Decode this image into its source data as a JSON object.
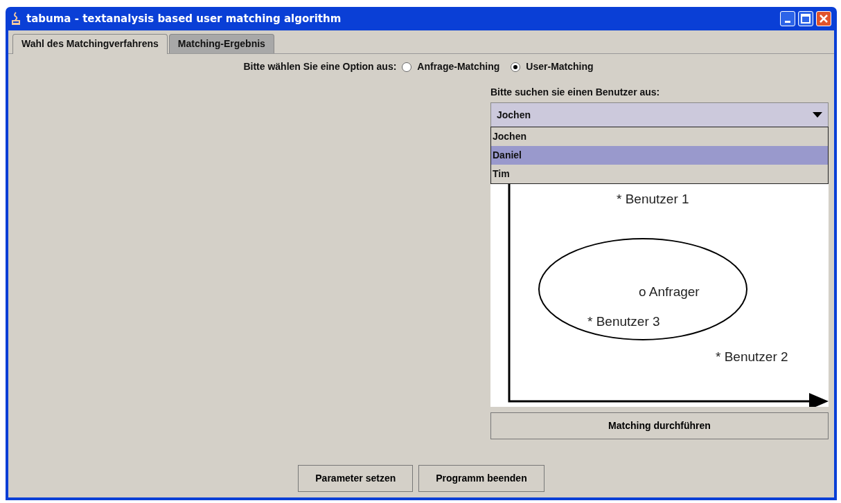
{
  "window": {
    "title": "tabuma - textanalysis based user matching algorithm"
  },
  "tabs": [
    {
      "label": "Wahl des Matchingverfahrens",
      "selected": true
    },
    {
      "label": "Matching-Ergebnis",
      "selected": false
    }
  ],
  "option_group": {
    "label": "Bitte wählen Sie eine Option aus:",
    "options": [
      {
        "label": "Anfrage-Matching",
        "selected": false
      },
      {
        "label": "User-Matching",
        "selected": true
      }
    ]
  },
  "user_select": {
    "label": "Bitte suchen sie einen Benutzer aus:",
    "value": "Jochen",
    "expanded": true,
    "options": [
      {
        "label": "Jochen",
        "highlighted": false
      },
      {
        "label": "Daniel",
        "highlighted": true
      },
      {
        "label": "Tim",
        "highlighted": false
      }
    ]
  },
  "diagram": {
    "labels": [
      "* Benutzer 1",
      "o Anfrager",
      "* Benutzer 3",
      "* Benutzer 2"
    ]
  },
  "run_button": "Matching durchführen",
  "buttons": [
    "Parameter setzen",
    "Programm beenden"
  ]
}
